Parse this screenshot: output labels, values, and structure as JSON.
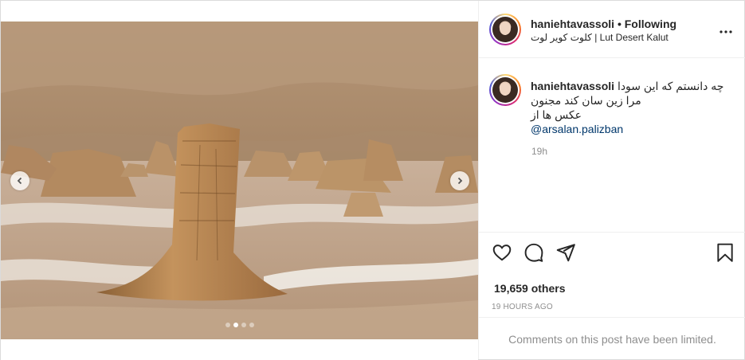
{
  "header": {
    "username": "haniehtavassoli",
    "separator": "•",
    "follow_status": "Following",
    "location": "کلوت کویر لوت | Lut Desert Kalut"
  },
  "caption": {
    "username": "haniehtavassoli",
    "lines": [
      "چه دانستم که این سودا",
      "مرا زین سان کند مجنون",
      "عکس ها از"
    ],
    "mention": "@arsalan.palizban",
    "time": "19h"
  },
  "likes_text": "19,659 others",
  "timestamp": "19 HOURS AGO",
  "comments_notice": "Comments on this post have been limited.",
  "carousel": {
    "current": 2,
    "total": 4
  },
  "icons": {
    "more": "more-options-icon",
    "like": "heart-icon",
    "comment": "comment-icon",
    "share": "share-icon",
    "save": "bookmark-icon",
    "prev": "chevron-left-icon",
    "next": "chevron-right-icon"
  },
  "colors": {
    "link": "#00376b",
    "muted": "#8e8e8e",
    "text": "#262626",
    "border": "#dbdbdb"
  }
}
